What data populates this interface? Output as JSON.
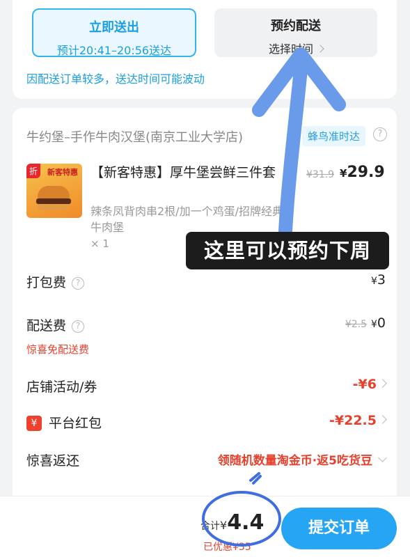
{
  "delivery": {
    "now_title": "立即送出",
    "now_subtitle": "预计20:41–20:56送达",
    "scheduled_title": "预约配送",
    "scheduled_subtitle": "选择时间",
    "notice": "因配送订单较多，送达时间可能波动"
  },
  "shop": {
    "name": "牛约堡–手作牛肉汉堡(南京工业大学店)",
    "badge": "蜂鸟准时达"
  },
  "product": {
    "image_tag": "折",
    "image_text": "新客特惠",
    "title": "【新客特惠】厚牛堡尝鲜三件套",
    "description": "辣条凤背肉串2根/加一个鸡蛋/招牌经典牛肉堡",
    "quantity": "× 1",
    "old_price": "¥31.9",
    "currency": "¥",
    "price": "29.9"
  },
  "fees": {
    "packaging_label": "打包费",
    "packaging_value": "3",
    "delivery_label": "配送费",
    "delivery_old": "¥2.5",
    "delivery_value": "0",
    "delivery_note": "惊喜免配送费",
    "store_promo_label": "店铺活动/券",
    "store_promo_value": "-¥6",
    "platform_label": "平台红包",
    "platform_icon": "¥",
    "platform_value": "-¥22.5",
    "return_label": "惊喜返还",
    "return_value": "领随机数量淘金币·返5吃货豆"
  },
  "footer": {
    "total_prefix": "合计",
    "currency": "¥",
    "total": "4.4",
    "saved": "已优惠¥35",
    "submit_label": "提交订单"
  },
  "annotation": {
    "tooltip": "这里可以预约下周"
  },
  "colors": {
    "accent_blue": "#26a5f5",
    "price_red": "#e5412d",
    "annotation_arrow": "#6a9bea"
  }
}
